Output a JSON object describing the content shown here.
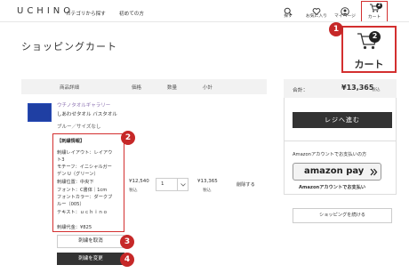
{
  "header": {
    "logo": "UCHINO",
    "nav": [
      "カテゴリから探す",
      "初めての方"
    ],
    "icons": [
      {
        "name": "search-icon",
        "label": "探す"
      },
      {
        "name": "heart-icon",
        "label": "お気に入り"
      },
      {
        "name": "user-icon",
        "label": "マイページ"
      },
      {
        "name": "cart-icon",
        "label": "カート",
        "badge": "2"
      }
    ]
  },
  "page": {
    "title": "ショッピングカート"
  },
  "table": {
    "headers": [
      "商品詳細",
      "価格",
      "数量",
      "小計"
    ]
  },
  "product": {
    "brand": "ウチノタオルギャラリー",
    "name": "しあわせタオル バスタオル",
    "variant": "ブルー／サイズなし",
    "price": "¥12,540",
    "price_note": "税込",
    "quantity": "1",
    "subtotal": "¥13,365",
    "subtotal_note": "税込",
    "delete_label": "削除する"
  },
  "embroidery": {
    "title": "【刺繍情報】",
    "lines": [
      "刺繍レイアウト：レイアウ",
      "ト3",
      "モチーフ：イニシャルガー",
      "デン U（グリーン）",
      "刺繍位置：中央下",
      "フォント：C書体｜1cm",
      "フォントカラー：ダークブ",
      "ルー（005）",
      "テキスト：ｕｃｈｉｎｏ"
    ],
    "fee": "刺繍代金：¥825",
    "cancel_label": "刺繍を取消",
    "change_label": "刺繍を変更"
  },
  "summary": {
    "total_label": "合計：",
    "total_value": "¥13,365",
    "total_note": "税込",
    "checkout_label": "レジへ進む",
    "amazon_heading": "Amazonアカウントでお支払いの方",
    "amazon_logo": "amazon pay",
    "amazon_sub": "Amazonアカウントでお支払い",
    "continue_label": "ショッピングを続ける"
  },
  "callout": {
    "label": "カート",
    "badge": "2"
  },
  "annotations": [
    "1",
    "2",
    "3",
    "4"
  ],
  "colors": {
    "accent_red": "#c62828",
    "product_blue": "#1f3fa3",
    "dark_button": "#333333"
  }
}
